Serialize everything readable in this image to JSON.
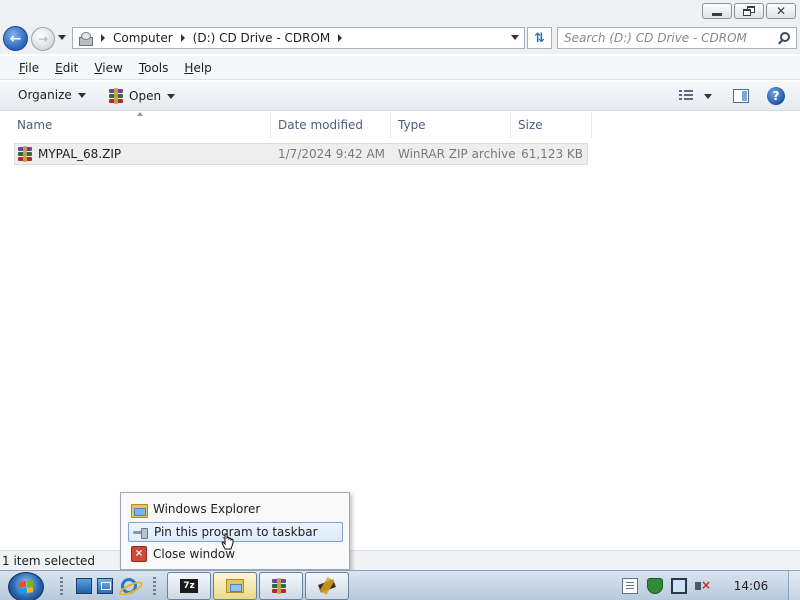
{
  "window": {
    "controls": {
      "minimize_icon": "minimize-icon",
      "maximize_icon": "restore-icon",
      "close_label": "✕"
    }
  },
  "navigation": {
    "back_icon": "back-arrow-icon",
    "forward_icon": "forward-arrow-icon",
    "breadcrumbs": [
      "Computer",
      "(D:) CD Drive - CDROM"
    ],
    "refresh_icon": "refresh-icon",
    "search_placeholder": "Search (D:) CD Drive - CDROM"
  },
  "menubar": {
    "items": [
      {
        "hotkey": "F",
        "rest": "ile"
      },
      {
        "hotkey": "E",
        "rest": "dit"
      },
      {
        "hotkey": "V",
        "rest": "iew"
      },
      {
        "hotkey": "T",
        "rest": "ools"
      },
      {
        "hotkey": "H",
        "rest": "elp"
      }
    ]
  },
  "commandbar": {
    "organize_label": "Organize",
    "open_label": "Open",
    "help_label": "?"
  },
  "filelist": {
    "columns": [
      "Name",
      "Date modified",
      "Type",
      "Size"
    ],
    "rows": [
      {
        "name": "MYPAL_68.ZIP",
        "date_modified": "1/7/2024 9:42 AM",
        "type": "WinRAR ZIP archive",
        "size": "61,123 KB",
        "selected": true
      }
    ]
  },
  "statusbar": {
    "text": "1 item selected"
  },
  "jumplist": {
    "items": [
      {
        "label": "Windows Explorer",
        "icon": "folder-icon"
      },
      {
        "label": "Pin this program to taskbar",
        "icon": "pin-icon",
        "highlighted": true
      },
      {
        "label": "Close window",
        "icon": "close-window-icon"
      }
    ]
  },
  "taskbar": {
    "sevenzip_label": "7z",
    "clock": "14:06",
    "colors": {
      "taskbar_top": "#d9e4ef",
      "taskbar_bottom": "#b7c9dc",
      "selection": "#dbeafc"
    }
  }
}
